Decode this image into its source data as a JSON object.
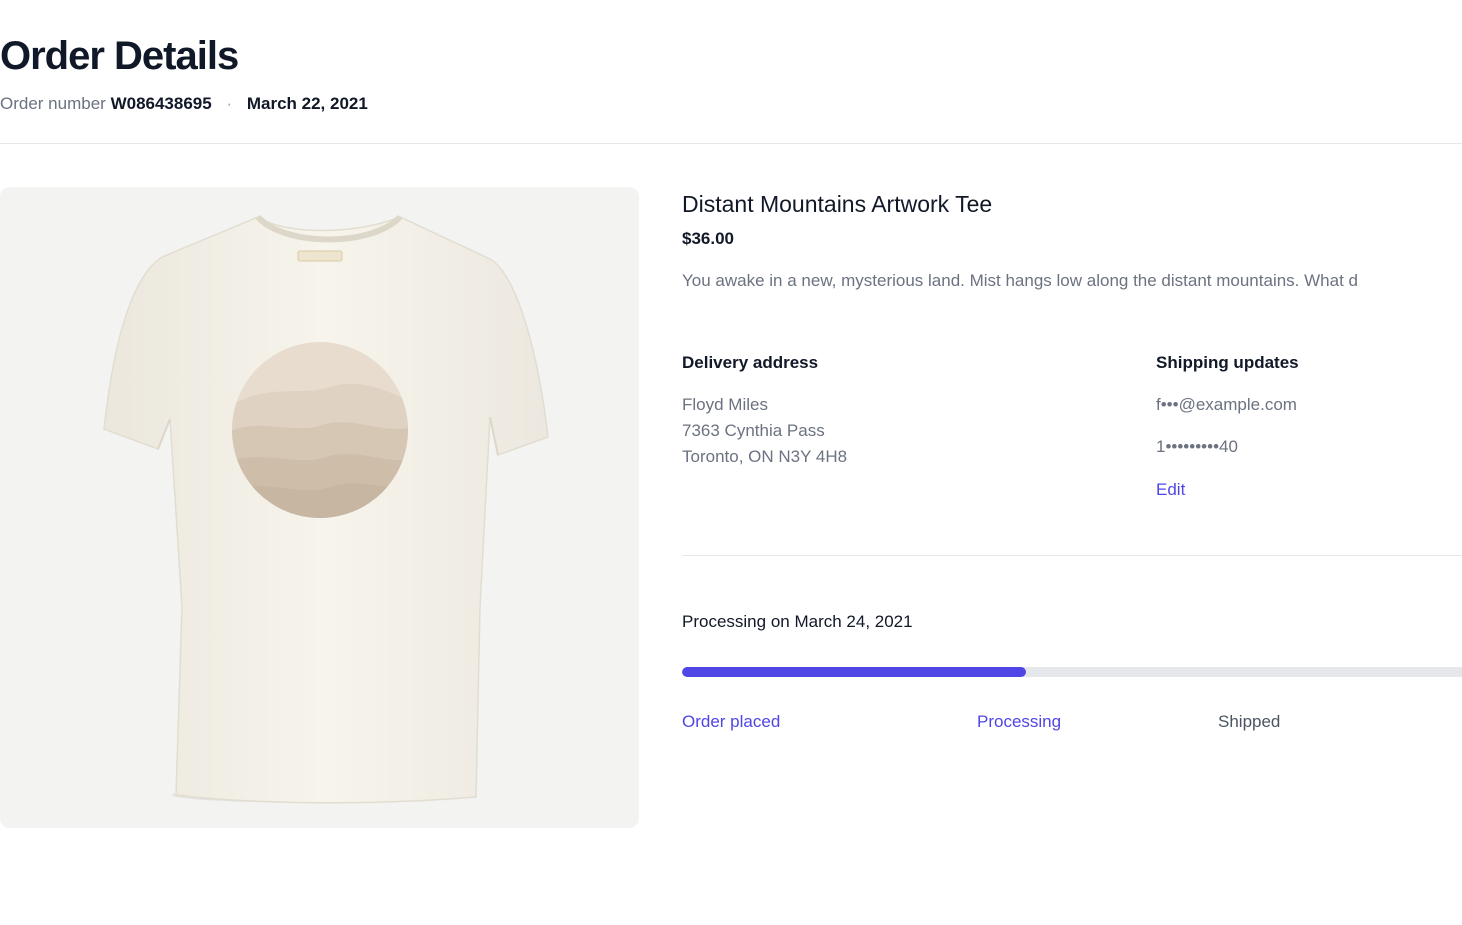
{
  "header": {
    "title": "Order Details",
    "order_number_label": "Order number",
    "order_number": "W086438695",
    "separator": "·",
    "order_date": "March 22, 2021"
  },
  "product": {
    "name": "Distant Mountains Artwork Tee",
    "price": "$36.00",
    "description": "You awake in a new, mysterious land. Mist hangs low along the distant mountains. What d",
    "image": "white-tshirt-with-mountain-circle-print"
  },
  "delivery": {
    "label": "Delivery address",
    "lines": [
      "Floyd Miles",
      "7363 Cynthia Pass",
      "Toronto, ON N3Y 4H8"
    ]
  },
  "shipping": {
    "label": "Shipping updates",
    "email": "f•••@example.com",
    "phone": "1•••••••••40",
    "edit_label": "Edit"
  },
  "progress": {
    "status_text": "Processing on March 24, 2021",
    "fraction": 0.43,
    "steps": [
      {
        "label": "Order placed",
        "active": true
      },
      {
        "label": "Processing",
        "active": true
      },
      {
        "label": "Shipped",
        "active": false
      }
    ]
  },
  "colors": {
    "accent": "#4f46e5",
    "track": "#e5e7eb",
    "text_primary": "#111827",
    "text_secondary": "#6b7280"
  }
}
